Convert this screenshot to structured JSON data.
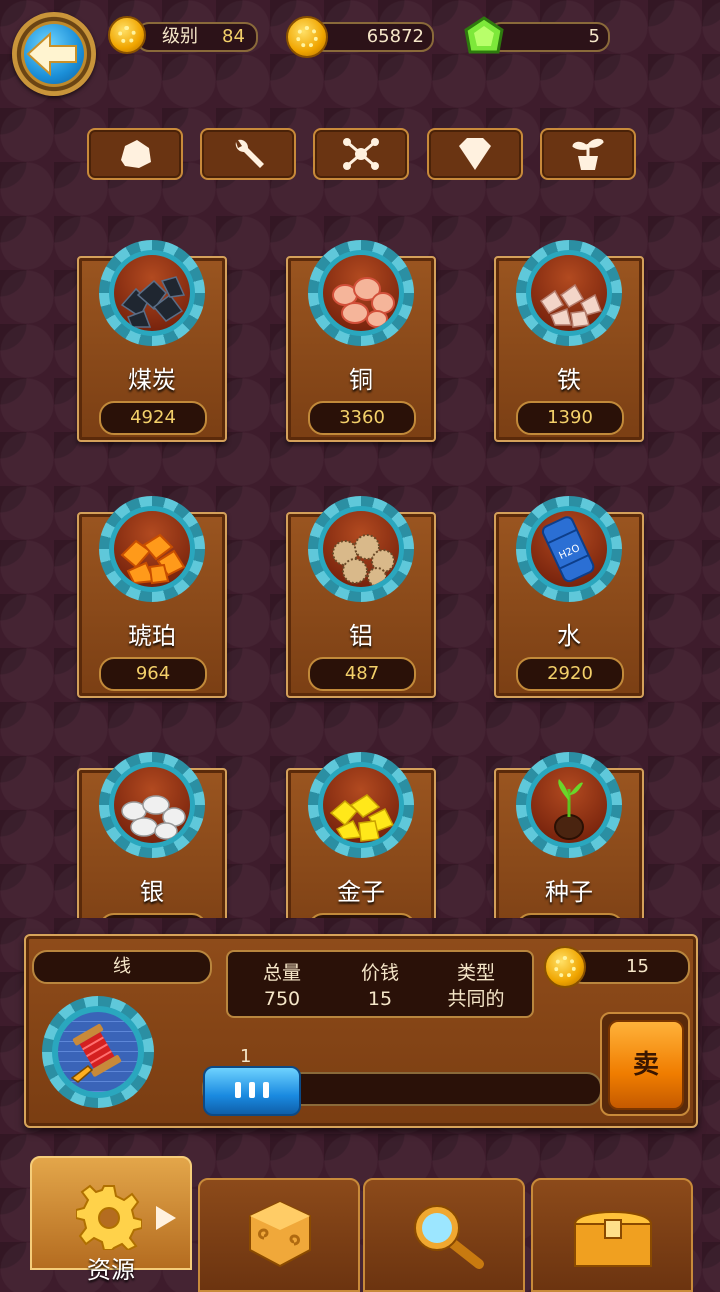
{
  "header": {
    "level_label": "级别",
    "level_value": "84",
    "coins": "65872",
    "gems": "5"
  },
  "filters": [
    {
      "icon": "rock-icon"
    },
    {
      "icon": "wrench-icon"
    },
    {
      "icon": "molecule-icon"
    },
    {
      "icon": "diamond-icon"
    },
    {
      "icon": "sprout-icon"
    }
  ],
  "resources": [
    {
      "name": "煤炭",
      "count": "4924",
      "icon": "coal-icon"
    },
    {
      "name": "铜",
      "count": "3360",
      "icon": "copper-icon"
    },
    {
      "name": "铁",
      "count": "1390",
      "icon": "iron-icon"
    },
    {
      "name": "琥珀",
      "count": "964",
      "icon": "amber-icon"
    },
    {
      "name": "铝",
      "count": "487",
      "icon": "aluminium-icon"
    },
    {
      "name": "水",
      "count": "2920",
      "icon": "water-barrel-icon"
    },
    {
      "name": "银",
      "count": "",
      "icon": "silver-icon"
    },
    {
      "name": "金子",
      "count": "",
      "icon": "gold-icon"
    },
    {
      "name": "种子",
      "count": "",
      "icon": "seed-icon"
    }
  ],
  "detail": {
    "item_name": "线",
    "total_label": "总量",
    "total_value": "750",
    "price_label": "价钱",
    "price_value": "15",
    "type_label": "类型",
    "type_value": "共同的",
    "sell_price": "15",
    "quantity": "1",
    "sell_label": "卖",
    "icon": "thread-spool-icon"
  },
  "nav": {
    "tabs": [
      {
        "label": "资源",
        "icon": "gear-icon",
        "active": true
      },
      {
        "label": "",
        "icon": "crate-icon"
      },
      {
        "label": "",
        "icon": "magnifier-icon"
      },
      {
        "label": "",
        "icon": "treasure-chest-icon"
      }
    ]
  },
  "colors": {
    "background": "#3e1c2c",
    "panel": "#8f4c1a",
    "accent_blue": "#1a8ae0",
    "accent_orange": "#f07d00",
    "count_text": "#f3d06a"
  }
}
